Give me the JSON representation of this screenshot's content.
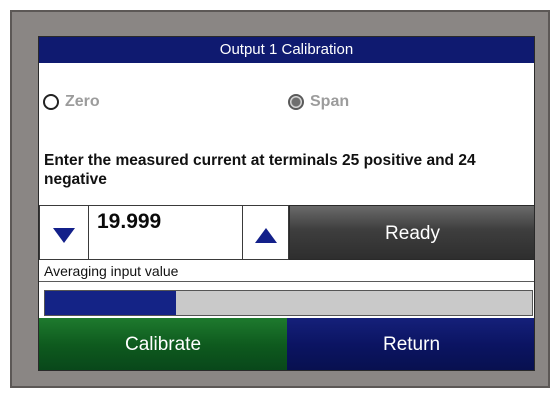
{
  "screen_title": "Output 1 Calibration",
  "mode_options": [
    {
      "label": "Zero",
      "selected": false
    },
    {
      "label": "Span",
      "selected": true
    }
  ],
  "instruction": "Enter the measured current at terminals 25 positive and 24 negative",
  "measured_value": "19.999",
  "status_button": "Ready",
  "status_message": "Averaging input value",
  "progress": 0.27,
  "buttons": {
    "calibrate": "Calibrate",
    "return": "Return"
  },
  "colors": {
    "title_bar": "#0f1a70",
    "arrow": "#13208a",
    "progress_fill": "#142386",
    "calibrate": "#0e5a1e",
    "return": "#0b1462",
    "ready": "#3e3e3e"
  },
  "icons": {
    "decrement": "triangle-down-icon",
    "increment": "triangle-up-icon"
  }
}
